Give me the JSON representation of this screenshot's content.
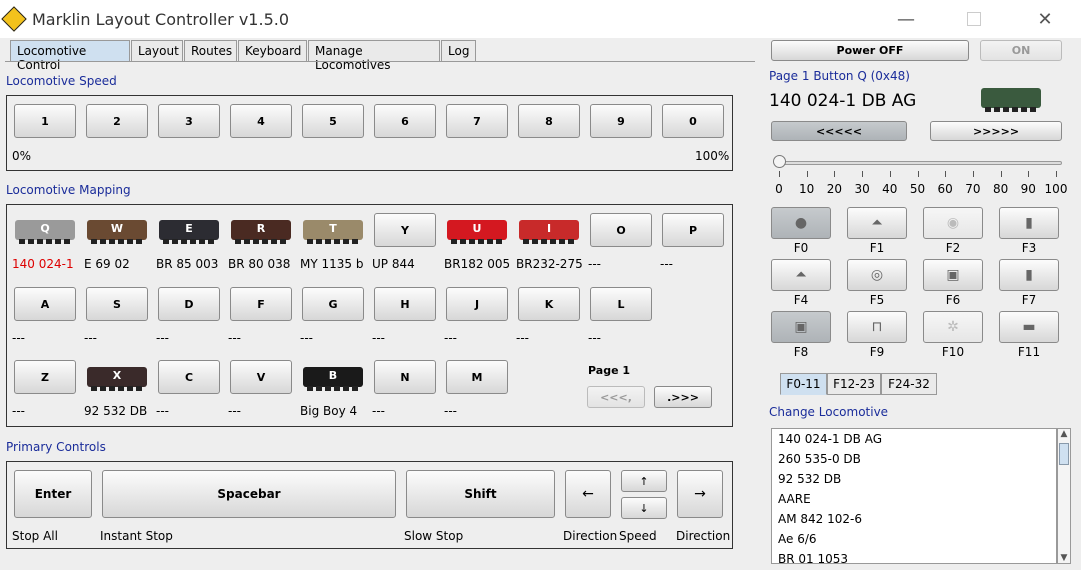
{
  "window": {
    "title": "Marklin Layout Controller v1.5.0",
    "min_icon": "minimize-icon",
    "max_icon": "maximize-icon",
    "close_icon": "close-icon"
  },
  "tabs": [
    {
      "label": "Locomotive Control",
      "active": true
    },
    {
      "label": "Layout"
    },
    {
      "label": "Routes"
    },
    {
      "label": "Keyboard"
    },
    {
      "label": "Manage Locomotives"
    },
    {
      "label": "Log"
    }
  ],
  "speed": {
    "title": "Locomotive Speed",
    "buttons": [
      "1",
      "2",
      "3",
      "4",
      "5",
      "6",
      "7",
      "8",
      "9",
      "0"
    ],
    "min_label": "0%",
    "max_label": "100%"
  },
  "mapping": {
    "title": "Locomotive Mapping",
    "row1": [
      {
        "key": "Q",
        "name": "140 024-1",
        "image": true,
        "color": "#9a9a9a",
        "active": true
      },
      {
        "key": "W",
        "name": "E 69 02",
        "image": true,
        "color": "#6a4a32"
      },
      {
        "key": "E",
        "name": "BR 85 003",
        "image": true,
        "color": "#2c2c32"
      },
      {
        "key": "R",
        "name": "BR 80 038",
        "image": true,
        "color": "#4a2a22"
      },
      {
        "key": "T",
        "name": "MY 1135 b",
        "image": true,
        "color": "#9a8a6a"
      },
      {
        "key": "Y",
        "name": "UP 844",
        "image": false
      },
      {
        "key": "U",
        "name": "BR182 005",
        "image": true,
        "color": "#d41820"
      },
      {
        "key": "I",
        "name": "BR232-275",
        "image": true,
        "color": "#c82a2a"
      },
      {
        "key": "O",
        "name": "---",
        "image": false
      },
      {
        "key": "P",
        "name": "---",
        "image": false
      }
    ],
    "row2": [
      {
        "key": "A",
        "name": "---"
      },
      {
        "key": "S",
        "name": "---"
      },
      {
        "key": "D",
        "name": "---"
      },
      {
        "key": "F",
        "name": "---"
      },
      {
        "key": "G",
        "name": "---"
      },
      {
        "key": "H",
        "name": "---"
      },
      {
        "key": "J",
        "name": "---"
      },
      {
        "key": "K",
        "name": "---"
      },
      {
        "key": "L",
        "name": "---"
      }
    ],
    "row3": [
      {
        "key": "Z",
        "name": "---",
        "image": false
      },
      {
        "key": "X",
        "name": "92 532 DB",
        "image": true,
        "color": "#3a2a2a"
      },
      {
        "key": "C",
        "name": "---",
        "image": false
      },
      {
        "key": "V",
        "name": "---",
        "image": false
      },
      {
        "key": "B",
        "name": "Big Boy 4",
        "image": true,
        "color": "#1a1a1a"
      },
      {
        "key": "N",
        "name": "---",
        "image": false
      },
      {
        "key": "M",
        "name": "---",
        "image": false
      }
    ],
    "page_label": "Page 1",
    "prev_label": "<<<,",
    "next_label": ".>>>"
  },
  "primary": {
    "title": "Primary Controls",
    "enter": "Enter",
    "spacebar": "Spacebar",
    "shift": "Shift",
    "left": "←",
    "up": "↑",
    "down": "↓",
    "right": "→",
    "stop_all": "Stop All",
    "instant_stop": "Instant Stop",
    "slow_stop": "Slow Stop",
    "direction_left": "Direction",
    "speed": "Speed",
    "direction_right": "Direction"
  },
  "right": {
    "power_off": "Power OFF",
    "on": "ON",
    "page_info": "Page 1 Button Q  (0x48)",
    "loco_name": "140 024-1 DB AG",
    "prev": "<<<<<",
    "next": ">>>>>",
    "speed_ticks": [
      "0",
      "10",
      "20",
      "30",
      "40",
      "50",
      "60",
      "70",
      "80",
      "90",
      "100"
    ],
    "speed_value": 0,
    "functions": [
      {
        "label": "F0",
        "icon": "headlight-icon",
        "state": "sel"
      },
      {
        "label": "F1",
        "icon": "horn-icon",
        "state": "on"
      },
      {
        "label": "F2",
        "icon": "cabin-light-icon",
        "state": "dis"
      },
      {
        "label": "F3",
        "icon": "pantograph-icon",
        "state": "on"
      },
      {
        "label": "F4",
        "icon": "horn-icon",
        "state": "on"
      },
      {
        "label": "F5",
        "icon": "sound-icon",
        "state": "on"
      },
      {
        "label": "F6",
        "icon": "loco-sound-icon",
        "state": "on"
      },
      {
        "label": "F7",
        "icon": "pantograph-icon",
        "state": "on"
      },
      {
        "label": "F8",
        "icon": "loco-sound-icon",
        "state": "sel"
      },
      {
        "label": "F9",
        "icon": "coupler-icon",
        "state": "on"
      },
      {
        "label": "F10",
        "icon": "fan-icon",
        "state": "dis"
      },
      {
        "label": "F11",
        "icon": "brake-icon",
        "state": "on"
      }
    ],
    "fn_tabs": [
      {
        "label": "F0-11",
        "active": true
      },
      {
        "label": "F12-23"
      },
      {
        "label": "F24-32"
      }
    ],
    "change_title": "Change Locomotive",
    "loco_list": [
      "140 024-1 DB AG",
      "260 535-0 DB",
      "92 532 DB",
      "AARE",
      "AM 842 102-6",
      "Ae 6/6",
      "BR 01 1053"
    ]
  }
}
